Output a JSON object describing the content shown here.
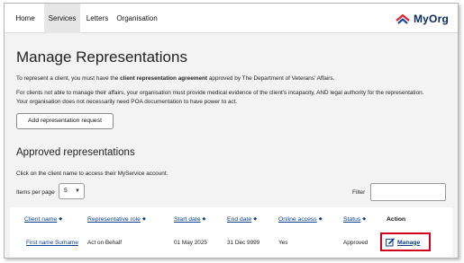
{
  "nav": {
    "tabs": [
      {
        "label": "Home",
        "active": false
      },
      {
        "label": "Services",
        "active": true
      },
      {
        "label": "Letters",
        "active": false
      },
      {
        "label": "Organisation",
        "active": false
      }
    ],
    "brand": "MyOrg"
  },
  "page": {
    "title": "Manage Representations",
    "intro_prefix": "To represent a client, you must have the ",
    "intro_bold": "client representation agreement",
    "intro_suffix": " approved by The Department of Veterans' Affairs.",
    "evidence_line1": "For clients not able to manage their affairs, your organisation must provide medical evidence of the client's incapacity, AND legal authority for the representation.",
    "evidence_line2": "Your organisation does not necessarily need POA documentation to have power to act.",
    "add_button": "Add representation request"
  },
  "approved": {
    "title": "Approved representations",
    "hint": "Click on the client name to access their MyService account.",
    "items_per_page_label": "Items per page",
    "items_per_page_value": "5",
    "filter_label": "Filter",
    "filter_value": "",
    "columns": [
      "Client name",
      "Representative role",
      "Start date",
      "End date",
      "Online access",
      "Status",
      "Action"
    ],
    "rows": [
      {
        "client_name": "First name Surname",
        "role": "Act on Behalf",
        "start": "01 May 2025",
        "end": "31 Dec 9999",
        "online": "Yes",
        "status": "Approved",
        "action": "Manage"
      }
    ]
  },
  "colors": {
    "link": "#0a3d8f",
    "highlight": "#d0021b",
    "brand": "#0b2a5b"
  }
}
